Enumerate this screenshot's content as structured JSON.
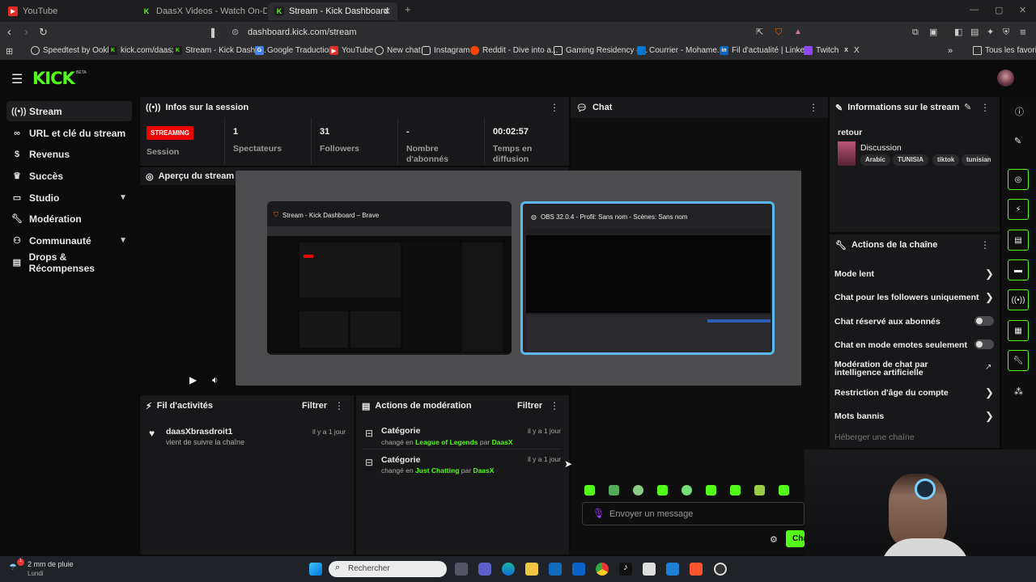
{
  "browser": {
    "tabs": [
      {
        "label": "YouTube",
        "icon": "youtube-icon"
      },
      {
        "label": "DaasX Videos - Watch On-Demand o",
        "icon": "kick-icon"
      },
      {
        "label": "Stream - Kick Dashboard",
        "icon": "kick-icon"
      }
    ],
    "url": "dashboard.kick.com/stream",
    "bookmarks": [
      "Speedtest by Ookla",
      "kick.com/daasx",
      "Stream - Kick Dashb...",
      "Google Traduction",
      "YouTube",
      "New chat",
      "Instagram",
      "Reddit - Dive into a...",
      "Gaming Residency –...",
      "Courrier - Mohame...",
      "Fil d'actualité | Linke...",
      "Twitch",
      "X"
    ],
    "all_bookmarks": "Tous les favoris"
  },
  "app": {
    "logo": "KICK",
    "beta": "BETA"
  },
  "sidebar": [
    {
      "label": "Stream",
      "icon": "broadcast-icon"
    },
    {
      "label": "URL et clé du stream",
      "icon": "link-icon"
    },
    {
      "label": "Revenus",
      "icon": "dollar-icon"
    },
    {
      "label": "Succès",
      "icon": "trophy-icon"
    },
    {
      "label": "Studio",
      "icon": "studio-icon"
    },
    {
      "label": "Modération",
      "icon": "wrench-icon"
    },
    {
      "label": "Communauté",
      "icon": "community-icon"
    },
    {
      "label": "Drops & Récompenses",
      "icon": "drops-icon"
    }
  ],
  "session": {
    "title": "Infos sur la session",
    "badge": "STREAMING",
    "badge_label": "Session",
    "stats": [
      {
        "value": "1",
        "label": "Spectateurs"
      },
      {
        "value": "31",
        "label": "Followers"
      },
      {
        "value": "-",
        "label": "Nombre d'abonnés"
      },
      {
        "value": "00:02:57",
        "label": "Temps en diffusion"
      }
    ]
  },
  "preview": {
    "title": "Aperçu du stream"
  },
  "switcher": [
    {
      "title": "Stream - Kick Dashboard – Brave"
    },
    {
      "title": "OBS 32.0.4 - Profil: Sans nom - Scènes: Sans nom"
    }
  ],
  "activity": {
    "title": "Fil d'activités",
    "filter": "Filtrer",
    "items": [
      {
        "user": "daasXbrasdroit1",
        "text": "vient de suivre la chaîne",
        "time": "il y a 1 jour"
      }
    ]
  },
  "modactions": {
    "title": "Actions de modération",
    "filter": "Filtrer",
    "items": [
      {
        "title": "Catégorie",
        "pre": "changé en",
        "value": "League of Legends",
        "by": "par",
        "user": "DaasX",
        "time": "il y a 1 jour"
      },
      {
        "title": "Catégorie",
        "pre": "changé en",
        "value": "Just Chatting",
        "by": "par",
        "user": "DaasX",
        "time": "il y a 1 jour"
      }
    ]
  },
  "chat": {
    "title": "Chat",
    "placeholder": "Envoyer un message",
    "send": "Cha"
  },
  "streaminfo": {
    "title": "Informations sur le stream",
    "stream_title": "retour",
    "category": "Discussion",
    "tags": [
      "Arabic",
      "TUNISIA",
      "tiktok",
      "tunisian"
    ]
  },
  "channel_actions": {
    "title": "Actions de la chaîne",
    "items": [
      {
        "label": "Mode lent",
        "control": "arrow"
      },
      {
        "label": "Chat pour les followers uniquement",
        "control": "arrow"
      },
      {
        "label": "Chat réservé aux abonnés",
        "control": "toggle"
      },
      {
        "label": "Chat en mode emotes seulement",
        "control": "toggle"
      },
      {
        "label": "Modération de chat par intelligence artificielle",
        "control": "external"
      },
      {
        "label": "Restriction d'âge du compte",
        "control": "arrow"
      },
      {
        "label": "Mots bannis",
        "control": "arrow"
      },
      {
        "label": "Héberger une chaîne",
        "control": "none"
      }
    ]
  },
  "taskbar": {
    "weather": "2 mm de pluie",
    "day": "Lundi",
    "search": "Rechercher"
  },
  "colors": {
    "accent": "#53fc18",
    "live": "#eb0400",
    "panel": "#18181a",
    "bg": "#0b0b0c"
  }
}
